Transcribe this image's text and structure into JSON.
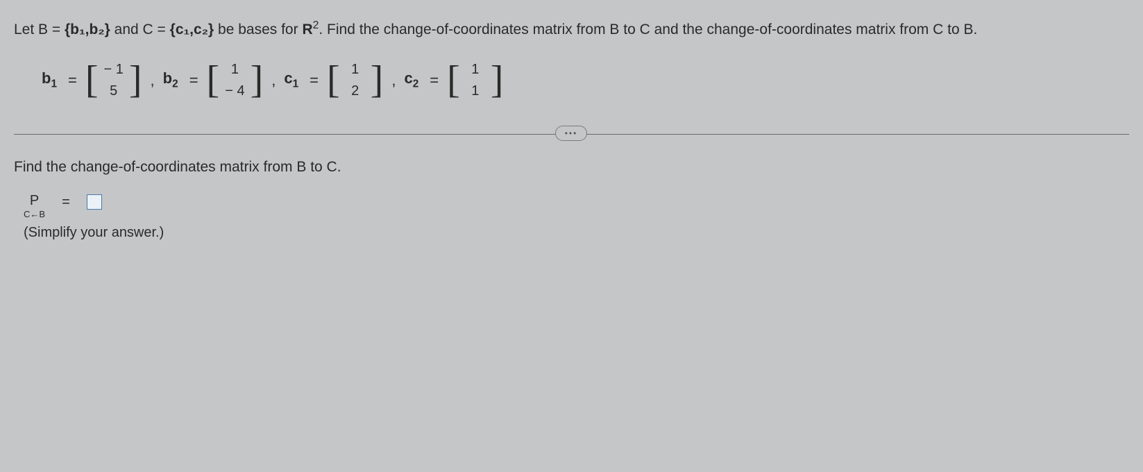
{
  "problem": {
    "text_part1": "Let B = ",
    "set_b": "{b₁,b₂}",
    "text_part2": " and C = ",
    "set_c": "{c₁,c₂}",
    "text_part3": " be bases for ",
    "space_base": "R",
    "space_sup": "2",
    "text_part4": ". Find the change-of-coordinates matrix from B to C and the change-of-coordinates matrix from C to B."
  },
  "vectors": {
    "b1": {
      "label_base": "b",
      "label_sub": "1",
      "r1": "− 1",
      "r2": "5"
    },
    "b2": {
      "label_base": "b",
      "label_sub": "2",
      "r1": "1",
      "r2": "− 4"
    },
    "c1": {
      "label_base": "c",
      "label_sub": "1",
      "r1": "1",
      "r2": "2"
    },
    "c2": {
      "label_base": "c",
      "label_sub": "2",
      "r1": "1",
      "r2": "1"
    }
  },
  "glyphs": {
    "lbracket": "[",
    "rbracket": "]",
    "comma": ",",
    "equals": "=",
    "dots": "•••"
  },
  "question": {
    "prompt": "Find the change-of-coordinates matrix from B to C.",
    "p_label": "P",
    "subscript": "C←B",
    "simplify": "(Simplify your answer.)"
  }
}
